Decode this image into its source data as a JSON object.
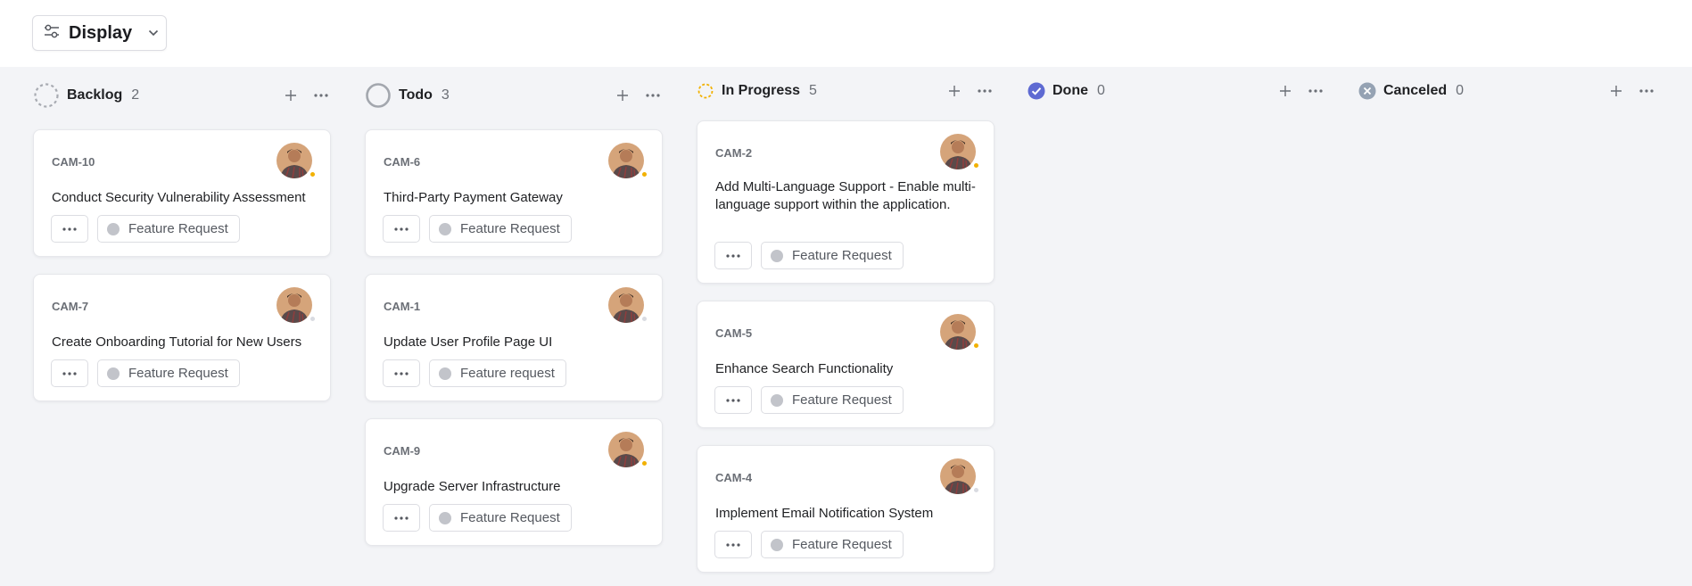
{
  "toolbar": {
    "display_label": "Display",
    "display_icon": "sliders-icon",
    "dropdown_icon": "chevron-down-icon"
  },
  "columns": [
    {
      "title": "Backlog",
      "count": "2",
      "status_icon": "backlog-dashed-circle-icon",
      "cards": [
        {
          "id": "CAM-10",
          "title": "Conduct Security Vulnerability Assessment",
          "label": "Feature Request",
          "avatar_dot": "orange"
        },
        {
          "id": "CAM-7",
          "title": "Create Onboarding Tutorial for New Users",
          "label": "Feature Request",
          "avatar_dot": "faint"
        }
      ]
    },
    {
      "title": "Todo",
      "count": "3",
      "status_icon": "todo-circle-icon",
      "cards": [
        {
          "id": "CAM-6",
          "title": "Third-Party Payment Gateway",
          "label": "Feature Request",
          "avatar_dot": "orange"
        },
        {
          "id": "CAM-1",
          "title": "Update User Profile Page UI",
          "label": "Feature request",
          "avatar_dot": "faint"
        },
        {
          "id": "CAM-9",
          "title": "Upgrade Server Infrastructure",
          "label": "Feature Request",
          "avatar_dot": "orange"
        }
      ]
    },
    {
      "title": "In Progress",
      "count": "5",
      "status_icon": "in-progress-circle-icon",
      "cards": [
        {
          "id": "CAM-2",
          "title": "Add Multi-Language Support - Enable multi-language support within the application.",
          "label": "Feature Request",
          "avatar_dot": "orange"
        },
        {
          "id": "CAM-5",
          "title": "Enhance Search Functionality",
          "label": "Feature Request",
          "avatar_dot": "orange"
        },
        {
          "id": "CAM-4",
          "title": "Implement Email Notification System",
          "label": "Feature Request",
          "avatar_dot": "faint"
        }
      ]
    },
    {
      "title": "Done",
      "count": "0",
      "status_icon": "done-check-circle-icon",
      "cards": []
    },
    {
      "title": "Canceled",
      "count": "0",
      "status_icon": "canceled-x-circle-icon",
      "cards": []
    }
  ],
  "colors": {
    "board_bg": "#f3f4f7",
    "in_progress": "#f2b100",
    "done": "#5e6ad2",
    "canceled": "#95a2b3",
    "todo": "#a3a7ae"
  }
}
